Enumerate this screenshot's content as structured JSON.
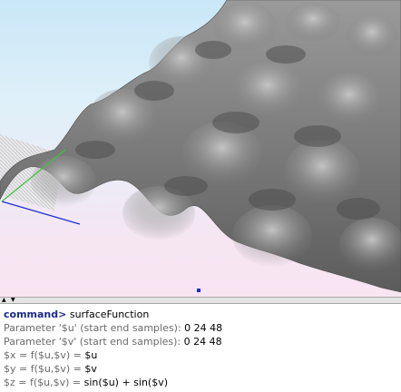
{
  "console": {
    "prompt": "command>",
    "command": "surfaceFunction",
    "lines": [
      {
        "label": "Parameter '$u' (start end samples):",
        "value": "0 24 48"
      },
      {
        "label": "Parameter '$v' (start end samples):",
        "value": "0 24 48"
      },
      {
        "label": "$x = f($u,$v) =",
        "value": "$u"
      },
      {
        "label": "$y = f($u,$v) =",
        "value": "$v"
      },
      {
        "label": "$z = f($u,$v) =",
        "value": "sin($u) + sin($v)"
      }
    ]
  },
  "colors": {
    "prompt": "#1a2a8a",
    "surface": "#7d7d7d",
    "axis_x": "#1d2dcf",
    "axis_y": "#3ac43a"
  },
  "icons": {
    "collapse_up": "triangle-up-icon",
    "expand_down": "triangle-down-icon"
  }
}
